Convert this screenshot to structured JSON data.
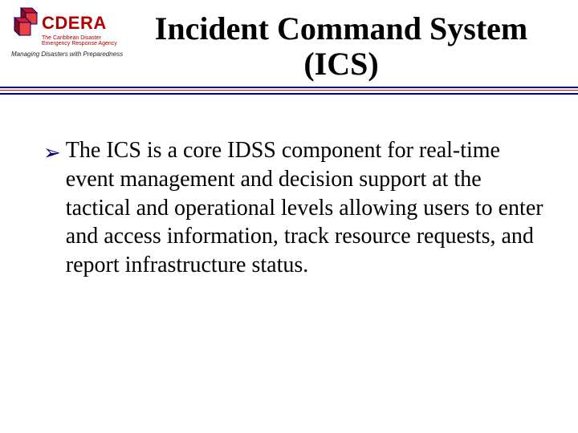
{
  "logo": {
    "name": "CDERA",
    "sub_line1": "The Caribbean Disaster",
    "sub_line2": "Emergency Response Agency",
    "tagline": "Managing Disasters with Preparedness"
  },
  "title_line1": "Incident Command System",
  "title_line2": "(ICS)",
  "bullet_marker": "➢",
  "bullet_text": "The ICS is a core IDSS component for real-time event management and decision support at the tactical and operational levels allowing users to enter and access information, track resource requests, and report infrastructure status."
}
